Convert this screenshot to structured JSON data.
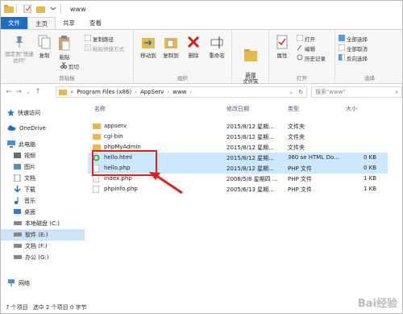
{
  "window": {
    "title": "www"
  },
  "tabs": [
    {
      "label": "文件"
    },
    {
      "label": "主页"
    },
    {
      "label": "共享"
    },
    {
      "label": "查看"
    }
  ],
  "ribbon": {
    "clipboard": {
      "label": "剪贴板",
      "pin_label": "固定到\"快速访问\"",
      "copy_label": "复制",
      "paste_label": "粘贴",
      "copy_path_label": "复制路径",
      "paste_shortcut_label": "粘贴快捷方式",
      "cut_label": "剪切"
    },
    "organize": {
      "label": "组织",
      "move_to_label": "移动到",
      "copy_to_label": "复制到",
      "delete_label": "删除",
      "rename_label": "重命名"
    },
    "new": {
      "label": "新建",
      "new_folder_label": "新建\n文件夹"
    },
    "open": {
      "label": "打开",
      "properties_label": "属性",
      "open_label": "打开",
      "edit_label": "编辑",
      "history_label": "历史记录"
    },
    "select": {
      "label": "选择",
      "select_all_label": "全部选择",
      "select_none_label": "全部取消",
      "invert_label": "反向选择"
    }
  },
  "address": {
    "path": [
      "Program Files (x86)",
      "AppServ",
      "www"
    ],
    "search_placeholder": "搜索\"www\""
  },
  "nav": {
    "quick_access": "快速访问",
    "onedrive": "OneDrive",
    "this_pc": "此电脑",
    "items": [
      "视频",
      "图片",
      "文档",
      "下载",
      "音乐",
      "桌面"
    ],
    "drives": [
      "本地磁盘 (C:)",
      "软件 (E:)",
      "文档 (F:)",
      "办公 (G:)"
    ],
    "network": "网络"
  },
  "columns": {
    "name": "名称",
    "date": "修改日期",
    "type": "类型",
    "size": "大小"
  },
  "files": [
    {
      "name": "appserv",
      "date": "2015/8/12 星期...",
      "type": "文件夹",
      "size": "",
      "icon": "folder-icon"
    },
    {
      "name": "cgi-bin",
      "date": "2015/8/12 星期...",
      "type": "文件夹",
      "size": "",
      "icon": "folder-icon"
    },
    {
      "name": "phpMyAdmin",
      "date": "2015/8/12 星期...",
      "type": "文件夹",
      "size": "",
      "icon": "folder-icon"
    },
    {
      "name": "hello.html",
      "date": "2015/8/12 星期...",
      "type": "360 se HTML Do...",
      "size": "0 KB",
      "icon": "html-file-icon"
    },
    {
      "name": "hello.php",
      "date": "2015/8/12 星期...",
      "type": "PHP 文件",
      "size": "0 KB",
      "icon": "php-file-icon"
    },
    {
      "name": "index.php",
      "date": "2008/5/8 星期四 ...",
      "type": "PHP 文件",
      "size": "1 KB",
      "icon": "php-file-icon"
    },
    {
      "name": "phpinfo.php",
      "date": "2005/6/13 星期...",
      "type": "PHP 文件",
      "size": "1 KB",
      "icon": "php-file-icon"
    }
  ],
  "status": {
    "count": "7 个项目",
    "selected": "选中 2 个项目 0 字节"
  },
  "watermark": "Bai经验",
  "colors": {
    "accent": "#1f6cc1",
    "selection": "#cce8ff",
    "highlight": "#e02020"
  }
}
